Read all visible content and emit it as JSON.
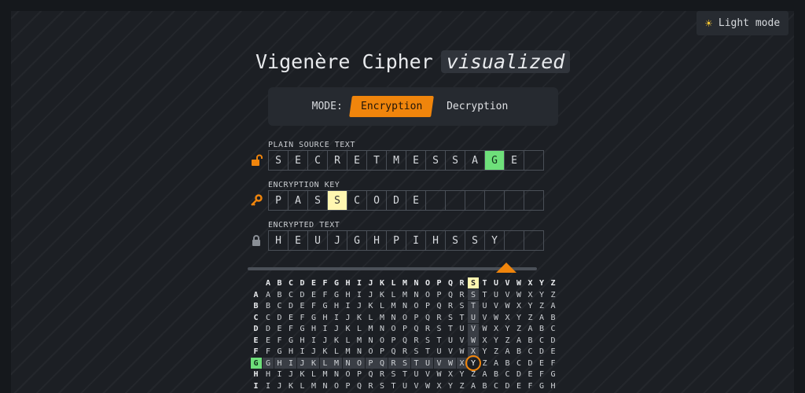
{
  "light_mode_label": "Light mode",
  "title": {
    "main": "Vigenère Cipher",
    "accent": "visualized"
  },
  "mode": {
    "label": "MODE:",
    "encryption": "Encryption",
    "decryption": "Decryption"
  },
  "plain": {
    "label": "PLAIN SOURCE TEXT",
    "letters": [
      "S",
      "E",
      "C",
      "R",
      "E",
      "T",
      "M",
      "E",
      "S",
      "S",
      "A",
      "G",
      "E",
      ""
    ],
    "highlight_index": 11
  },
  "key": {
    "label": "ENCRYPTION KEY",
    "letters": [
      "P",
      "A",
      "S",
      "S",
      "C",
      "O",
      "D",
      "E",
      "",
      "",
      "",
      "",
      "",
      ""
    ],
    "highlight_index": 3
  },
  "encrypted": {
    "label": "ENCRYPTED TEXT",
    "letters": [
      "H",
      "E",
      "U",
      "J",
      "G",
      "H",
      "P",
      "I",
      "H",
      "S",
      "S",
      "Y",
      "",
      ""
    ]
  },
  "slider": {
    "position": 0.92
  },
  "tableau": {
    "alphabet": [
      "A",
      "B",
      "C",
      "D",
      "E",
      "F",
      "G",
      "H",
      "I",
      "J",
      "K",
      "L",
      "M",
      "N",
      "O",
      "P",
      "Q",
      "R",
      "S",
      "T",
      "U",
      "V",
      "W",
      "X",
      "Y",
      "Z"
    ],
    "visible_rows": 9,
    "highlight_col": "S",
    "highlight_row": "G",
    "result": "Y"
  },
  "colors": {
    "accent": "#f0850c",
    "green": "#6ee07a",
    "yellow": "#fff6b0"
  }
}
